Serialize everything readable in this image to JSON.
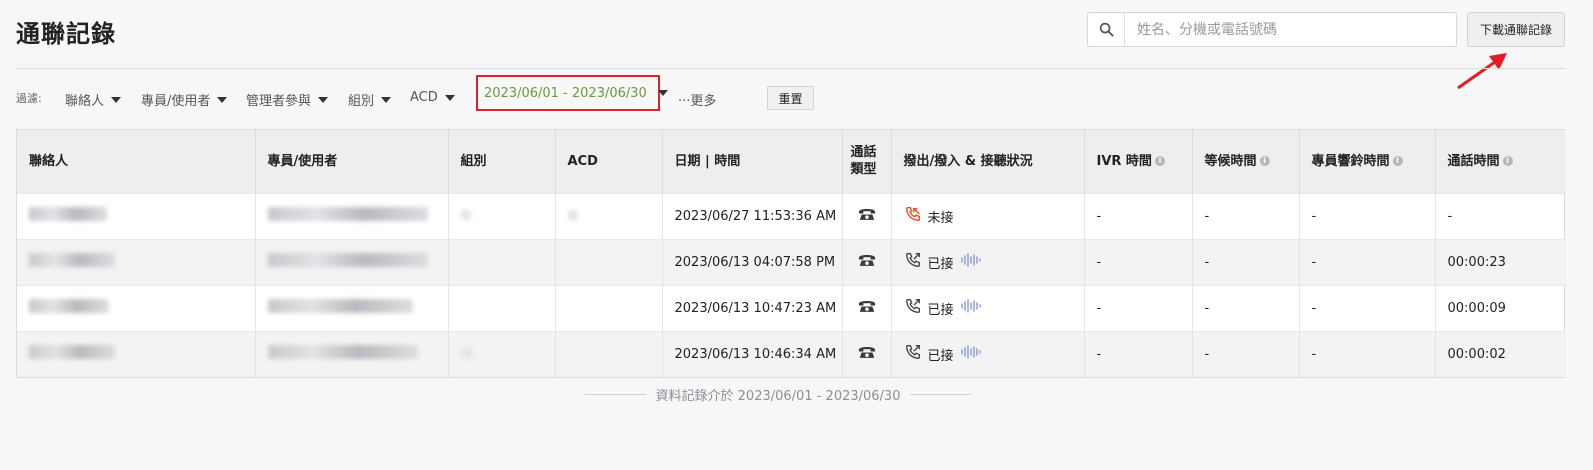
{
  "header": {
    "title": "通聯記錄",
    "search_placeholder": "姓名、分機或電話號碼",
    "download_label": "下載通聯記錄"
  },
  "filters": {
    "label": "過濾:",
    "items": [
      "聯絡人",
      "專員/使用者",
      "管理者參與",
      "組別",
      "ACD"
    ],
    "date_range": "2023/06/01 - 2023/06/30",
    "more": "···更多",
    "reset": "重置"
  },
  "table": {
    "columns": [
      "聯絡人",
      "專員/使用者",
      "組別",
      "ACD",
      "日期 | 時間",
      "通話類型",
      "撥出/撥入 & 接聽狀況",
      "IVR 時間",
      "等候時間",
      "專員響鈴時間",
      "通話時間"
    ],
    "rows": [
      {
        "datetime": "2023/06/27 11:53:36 AM",
        "status": "未接",
        "ivr": "-",
        "wait": "-",
        "ring": "-",
        "duration": "-",
        "missed": true
      },
      {
        "datetime": "2023/06/13 04:07:58 PM",
        "status": "已接",
        "ivr": "-",
        "wait": "-",
        "ring": "-",
        "duration": "00:00:23",
        "missed": false
      },
      {
        "datetime": "2023/06/13 10:47:23 AM",
        "status": "已接",
        "ivr": "-",
        "wait": "-",
        "ring": "-",
        "duration": "00:00:09",
        "missed": false
      },
      {
        "datetime": "2023/06/13 10:46:34 AM",
        "status": "已接",
        "ivr": "-",
        "wait": "-",
        "ring": "-",
        "duration": "00:00:02",
        "missed": false
      }
    ]
  },
  "footer": {
    "note": "資料記錄介於 2023/06/01 - 2023/06/30"
  },
  "colors": {
    "accent_red": "#d9232e",
    "date_green": "#6c9a3a",
    "missed_icon": "#e8532b",
    "wave": "#8c9ad0"
  },
  "icons": {
    "search": "search-icon",
    "phone": "telephone-icon",
    "missed": "missed-call-icon",
    "answered": "outgoing-call-icon",
    "recording": "sound-wave-icon",
    "info": "info-icon"
  }
}
